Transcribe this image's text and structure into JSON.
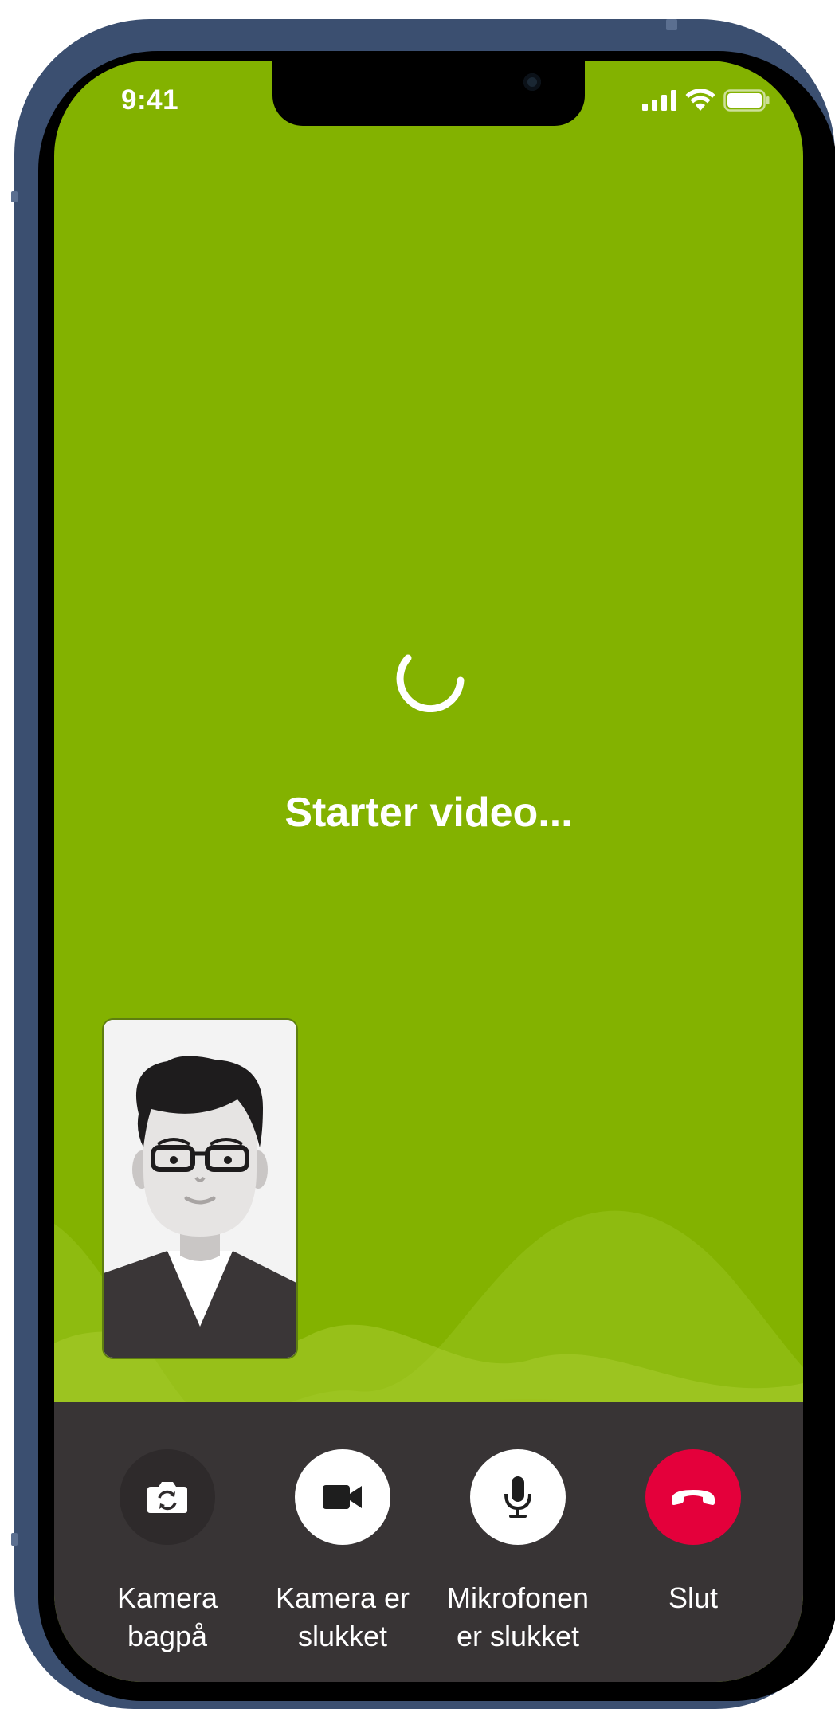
{
  "status_bar": {
    "time": "9:41"
  },
  "main": {
    "status_text": "Starter video..."
  },
  "controls": [
    {
      "id": "flip-camera",
      "line1": "Kamera",
      "line2": "bagpå",
      "icon": "camera-flip-icon",
      "bg": "#2e2a2b",
      "icon_color": "#ffffff"
    },
    {
      "id": "camera",
      "line1": "Kamera er",
      "line2": "slukket",
      "icon": "video-camera-icon",
      "bg": "#ffffff",
      "icon_color": "#1e1e1e"
    },
    {
      "id": "microphone",
      "line1": "Mikrofonen",
      "line2": "er slukket",
      "icon": "microphone-icon",
      "bg": "#ffffff",
      "icon_color": "#1e1e1e"
    },
    {
      "id": "end-call",
      "line1": "Slut",
      "line2": "",
      "icon": "hang-up-icon",
      "bg": "#e4003b",
      "icon_color": "#ffffff"
    }
  ],
  "colors": {
    "screen_background": "#83b200",
    "controls_background": "#383435",
    "end_call": "#e4003b"
  }
}
